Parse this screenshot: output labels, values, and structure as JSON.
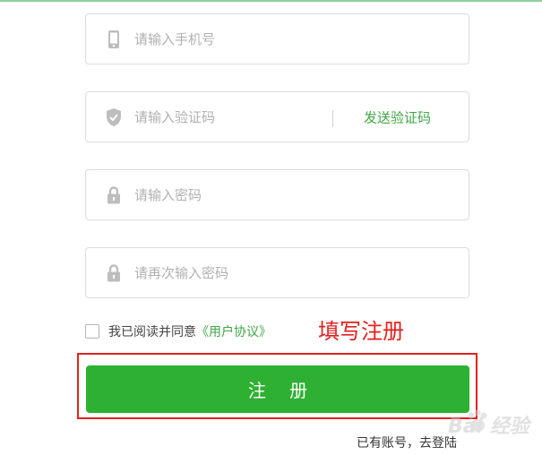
{
  "form": {
    "phone": {
      "placeholder": "请输入手机号",
      "value": "",
      "icon": "phone-icon"
    },
    "code": {
      "placeholder": "请输入验证码",
      "value": "",
      "icon": "shield-icon",
      "send_label": "发送验证码"
    },
    "password": {
      "placeholder": "请输入密码",
      "value": "",
      "icon": "lock-icon"
    },
    "password_confirm": {
      "placeholder": "请再次输入密码",
      "value": "",
      "icon": "lock-icon"
    },
    "agreement": {
      "checked": false,
      "text": "我已阅读并同意",
      "link": "《用户协议》"
    },
    "register_label": "注 册",
    "login_text": "已有账号，去登陆"
  },
  "annotation": {
    "text": "填写注册"
  },
  "watermark": {
    "text": "Bai 经验"
  },
  "colors": {
    "accent": "#2eb032",
    "link": "#3fa645",
    "annotation": "#e0211e",
    "border": "#dcdcdc"
  }
}
